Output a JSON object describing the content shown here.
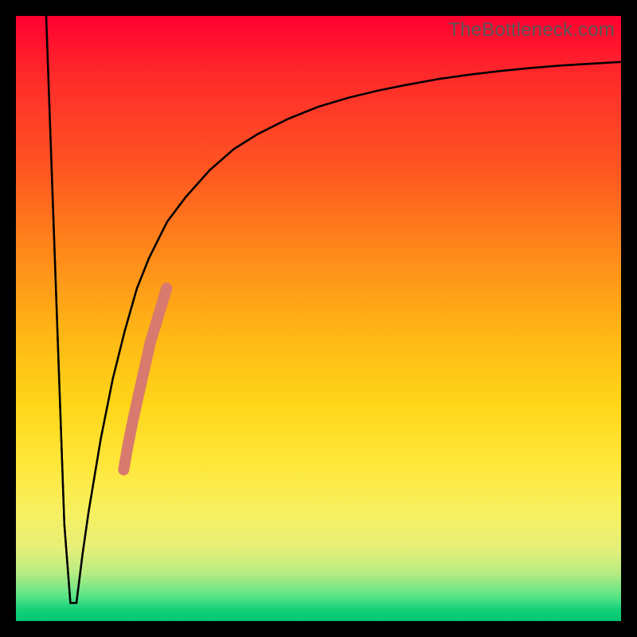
{
  "watermark": "TheBottleneck.com",
  "chart_data": {
    "type": "line",
    "title": "",
    "xlabel": "",
    "ylabel": "",
    "xlim": [
      0,
      100
    ],
    "ylim": [
      0,
      100
    ],
    "grid": false,
    "legend": false,
    "background_gradient": {
      "orientation": "vertical",
      "stops": [
        {
          "pos": 0.0,
          "color": "#ff0030"
        },
        {
          "pos": 0.5,
          "color": "#ffb515"
        },
        {
          "pos": 0.8,
          "color": "#ffe73a"
        },
        {
          "pos": 1.0,
          "color": "#00c574"
        }
      ]
    },
    "series": [
      {
        "name": "curve",
        "color": "#000000",
        "x": [
          5,
          6,
          7,
          8,
          9,
          10,
          11,
          12,
          14,
          16,
          18,
          20,
          22,
          25,
          28,
          32,
          36,
          40,
          45,
          50,
          55,
          60,
          65,
          70,
          75,
          80,
          85,
          90,
          95,
          100
        ],
        "y": [
          100,
          72,
          44,
          16,
          3,
          3,
          11,
          18,
          30,
          40,
          48,
          55,
          60,
          66,
          70,
          74.5,
          78,
          80.5,
          83,
          85,
          86.5,
          87.7,
          88.7,
          89.6,
          90.3,
          90.9,
          91.4,
          91.8,
          92.1,
          92.4
        ]
      }
    ],
    "highlight_segment": {
      "name": "bottleneck-range",
      "color": "#d87a6e",
      "points": [
        {
          "x": 17.8,
          "y": 25,
          "r": 5
        },
        {
          "x": 18.5,
          "y": 29,
          "r": 5
        },
        {
          "x": 19.3,
          "y": 33,
          "r": 5
        },
        {
          "x": 20.4,
          "y": 38,
          "r": 7
        },
        {
          "x": 21.3,
          "y": 42,
          "r": 7
        },
        {
          "x": 22.2,
          "y": 46,
          "r": 7
        },
        {
          "x": 23.1,
          "y": 49,
          "r": 7
        },
        {
          "x": 24.0,
          "y": 52,
          "r": 7
        },
        {
          "x": 24.9,
          "y": 55,
          "r": 7
        }
      ]
    }
  }
}
